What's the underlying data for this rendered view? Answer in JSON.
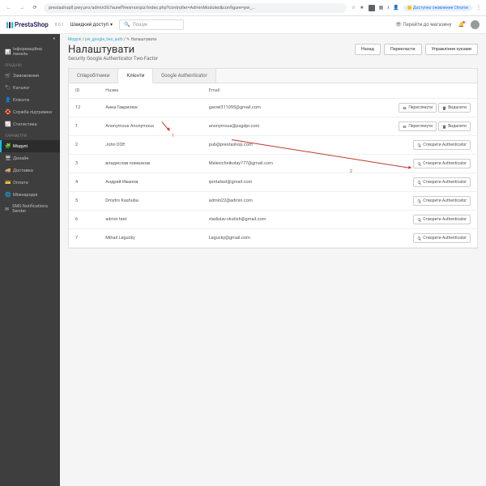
{
  "browser": {
    "url": "prestashop8.pwy.pro/admin367auref9rexmorqsz/index.php?controller=AdminModules&configure=pw_...",
    "chrome_update": "Доступно оновлення Chrome"
  },
  "header": {
    "logo": "PrestaShop",
    "version": "8.0.1",
    "quick_access": "Швидкий доступ",
    "search_placeholder": "Пошук",
    "goto_store": "Перейти до магазину"
  },
  "sidebar": {
    "dashboard": "Інформаційна панель",
    "section_sales": "ПРОДАЖІ",
    "orders": "Замовлення",
    "catalog": "Каталог",
    "customers": "Клієнти",
    "support": "Служба підтримки",
    "stats": "Статистика",
    "section_params": "ПАРАМЕТРИ",
    "modules": "Модулі",
    "design": "Дизайн",
    "shipping": "Доставка",
    "payment": "Оплата",
    "intl": "Міжнародні",
    "sms": "SMS Notifications Sender"
  },
  "breadcrumb": {
    "a": "Модулі",
    "b": "pw_google_two_auth",
    "c": "Налаштувати"
  },
  "page": {
    "title": "Налаштувати",
    "subtitle": "Security Google Authenticator Two-Factor",
    "btn_back": "Назад",
    "btn_translate": "Перекласти",
    "btn_hooks": "Управління хуками"
  },
  "tabs": {
    "employees": "Співробітники",
    "clients": "Клієнти",
    "ga": "Google Authenticator"
  },
  "table": {
    "col_id": "ID",
    "col_name": "Назва",
    "col_email": "Email",
    "btn_view": "Переглянути",
    "btn_delete": "Видалити",
    "btn_create": "Створити Authenticator",
    "rows": [
      {
        "id": "12",
        "name": "Анна Гаврилюк",
        "email": "gavrel311095@gmail.com",
        "kind": "viewdel"
      },
      {
        "id": "1",
        "name": "Anonymous Anonymous",
        "email": "anonymous@psgdpr.com",
        "kind": "viewdel"
      },
      {
        "id": "2",
        "name": "John DOE",
        "email": "pub@prestashop.com",
        "kind": "create"
      },
      {
        "id": "3",
        "name": "владислав помазков",
        "email": "Malevichnikolay777@gmail.com",
        "kind": "create"
      },
      {
        "id": "4",
        "name": "Андрей Иванов",
        "email": "ipintatest@gmail.com",
        "kind": "create"
      },
      {
        "id": "5",
        "name": "Dmytro Kashuba",
        "email": "admin22@admin.com",
        "kind": "create"
      },
      {
        "id": "6",
        "name": "admin test",
        "email": "vladislav.vkutish@gmail.com",
        "kind": "create"
      },
      {
        "id": "7",
        "name": "Mihail Legucky",
        "email": "Legucky@gmail.com",
        "kind": "create"
      }
    ]
  },
  "annotations": {
    "n1": "1",
    "n2": "2"
  }
}
